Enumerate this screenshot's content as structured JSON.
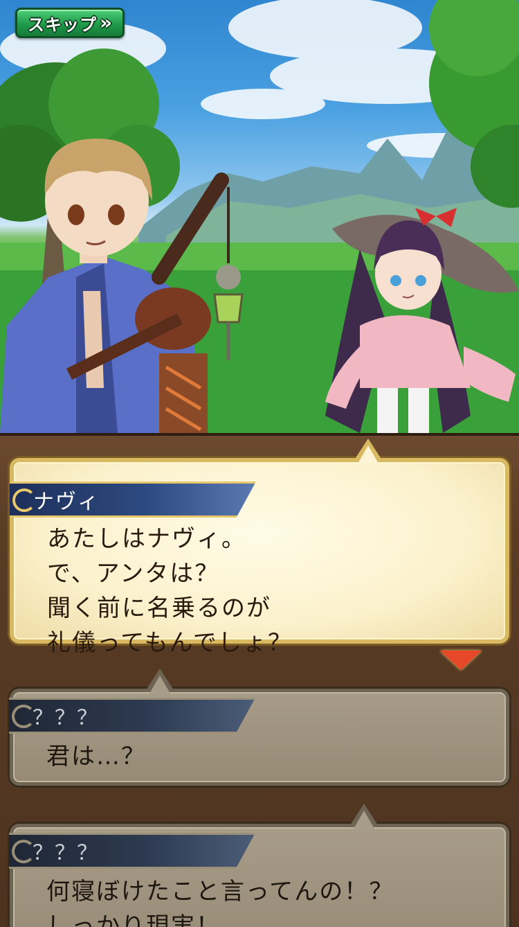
{
  "skip_button": {
    "label": "スキップ",
    "icon": "double-chevron-right-icon"
  },
  "dialogue_log": [
    {
      "speaker": "ナヴィ",
      "text": "あたしはナヴィ。\nで、アンタは？\n聞く前に名乗るのが\n礼儀ってもんでしょ？",
      "state": "current"
    },
    {
      "speaker": "？？？",
      "text": "君は…？",
      "state": "past"
    },
    {
      "speaker": "？？？",
      "text": "何寝ぼけたこと言ってんの！？\nしっかり現実！",
      "state": "past"
    }
  ],
  "colors": {
    "skip_green": "#1f9a4a",
    "active_bubble": "#fbf1cc",
    "past_bubble": "#a79c88",
    "nameplate_blue": "#2d4a80",
    "next_indicator": "#e8482a"
  }
}
